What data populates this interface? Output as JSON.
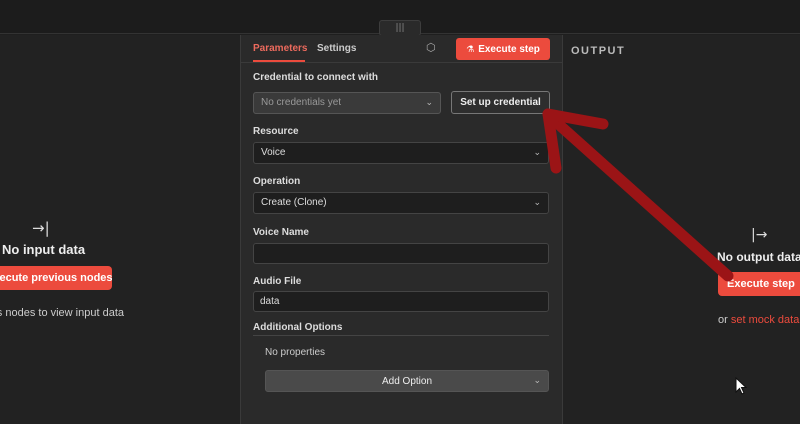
{
  "topbar": {
    "drag_handle": "|||"
  },
  "input_panel": {
    "icon": "→|",
    "title": "No input data",
    "execute_button": "Execute previous nodes",
    "hint": "Execute previous nodes to view input data"
  },
  "center_panel": {
    "tabs": {
      "parameters": "Parameters",
      "settings": "Settings"
    },
    "execute_button": "Execute step",
    "credential": {
      "label": "Credential to connect with",
      "placeholder": "No credentials yet",
      "setup_button": "Set up credential"
    },
    "resource": {
      "label": "Resource",
      "value": "Voice"
    },
    "operation": {
      "label": "Operation",
      "value": "Create (Clone)"
    },
    "voice_name": {
      "label": "Voice Name",
      "value": ""
    },
    "audio_file": {
      "label": "Audio File",
      "value": "data"
    },
    "additional_options": {
      "label": "Additional Options",
      "empty_text": "No properties",
      "add_button": "Add Option"
    }
  },
  "output_panel": {
    "header": "OUTPUT",
    "icon": "|→",
    "title": "No output data",
    "execute_button": "Execute step",
    "mock_prefix": "or",
    "mock_link": "set mock data"
  },
  "colors": {
    "accent": "#ec4b3d",
    "annotation_arrow": "#9b1416"
  }
}
